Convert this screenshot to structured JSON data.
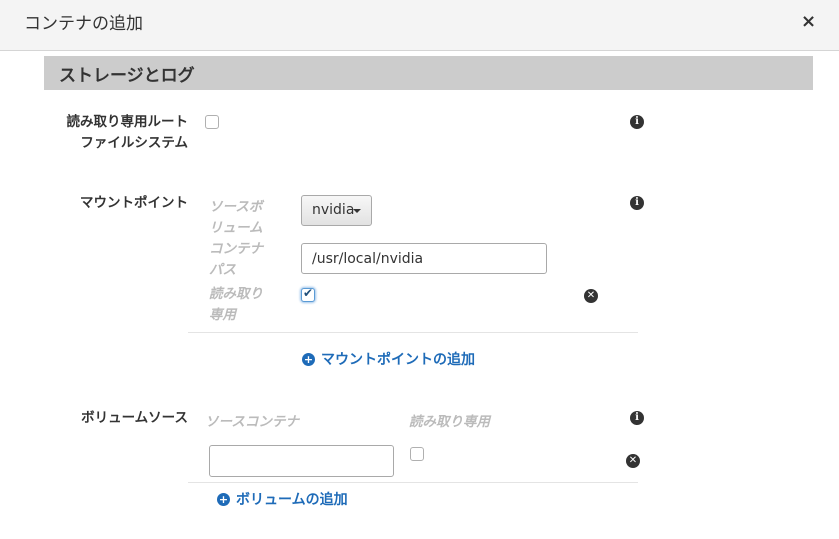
{
  "dialog": {
    "title": "コンテナの追加",
    "close_glyph": "×"
  },
  "section": {
    "title": "ストレージとログ"
  },
  "readonly_root": {
    "label_line1": "読み取り専用ルート",
    "label_line2": "ファイルシステム",
    "checked": false
  },
  "mount_points": {
    "label": "マウントポイント",
    "source_volume_line1": "ソースボ",
    "source_volume_line2": "リューム",
    "source_volume_value": "nvidia",
    "container_path_line1": "コンテナ",
    "container_path_line2": "パス",
    "container_path_value": "/usr/local/nvidia",
    "readonly_line1": "読み取り",
    "readonly_line2": "専用",
    "readonly_checked": true,
    "add_label": "マウントポイントの追加"
  },
  "volume_sources": {
    "label": "ボリュームソース",
    "source_container_header": "ソースコンテナ",
    "readonly_header": "読み取り専用",
    "source_container_value": "",
    "readonly_checked": false,
    "add_label": "ボリュームの追加"
  },
  "icons": {
    "info": "info-icon",
    "remove": "remove-icon",
    "add": "plus-circle-icon"
  },
  "colors": {
    "link": "#1e6bb8",
    "section_header_bg": "#cccccc",
    "titlebar_bg": "#f4f4f4"
  }
}
